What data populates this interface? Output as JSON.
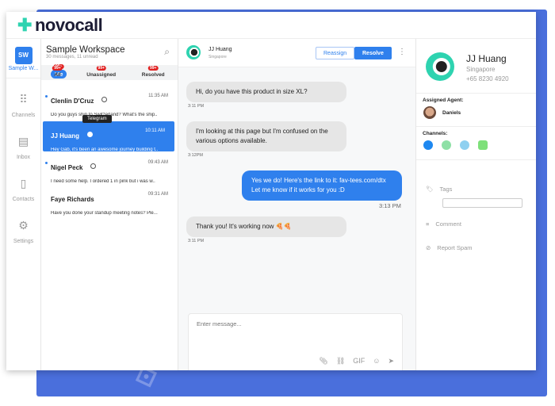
{
  "app": {
    "name": "novocall"
  },
  "rail": {
    "workspace_initials": "SW",
    "workspace_label": "Sample W...",
    "items": [
      {
        "label": "Channels",
        "icon": "grid-icon"
      },
      {
        "label": "Inbox",
        "icon": "chat-icon"
      },
      {
        "label": "Contacts",
        "icon": "book-icon"
      },
      {
        "label": "Settings",
        "icon": "gear-icon"
      }
    ]
  },
  "list": {
    "title": "Sample Workspace",
    "subtitle": "30 messages, 11 unread",
    "tabs": [
      {
        "label": "Me",
        "badge": "99+"
      },
      {
        "label": "All",
        "badge": "99+"
      },
      {
        "label": "Unassigned",
        "badge": "99+"
      },
      {
        "label": "Resolved",
        "badge": "99+"
      }
    ],
    "tooltip": "Telegram",
    "conversations": [
      {
        "name": "Clenlin D'Cruz",
        "time": "11:35 AM",
        "preview": "Do you guys ship to Switzerland? What's the ship..",
        "unread": true
      },
      {
        "name": "JJ Huang",
        "time": "10:11 AM",
        "preview": "Hey Gab, it's been an awesome journey building t..",
        "selected": true
      },
      {
        "name": "Nigel Peck",
        "time": "09:43 AM",
        "preview": "I need some help. I ordered 1 in pink but i was w..",
        "unread": true
      },
      {
        "name": "Faye Richards",
        "time": "09:31 AM",
        "preview": "Have you done your standup meeting notes? Ple..."
      }
    ]
  },
  "chat": {
    "name": "JJ Huang",
    "location": "Singapore",
    "reassign": "Reassign",
    "resolve": "Resolve",
    "messages": [
      {
        "text": "Hi, do you have this product in size XL?",
        "time": "3:11 PM"
      },
      {
        "text": "I'm looking at this page but I'm confused on the various options available.",
        "time": "3:12PM"
      },
      {
        "text": "Yes we do! Here's the link to it: fav-tees.com/dtx Let me know if it works for you :D",
        "time": "3:13 PM"
      },
      {
        "text": "Thank you! It's working now 🍕🍕",
        "time": "3:11 PM"
      }
    ],
    "placeholder": "Enter message...",
    "gif": "GIF"
  },
  "profile": {
    "name": "JJ Huang",
    "location": "Singapore",
    "phone": "+65 8230 4920",
    "assigned_label": "Assigned Agent:",
    "agent": "Daniels",
    "channels_label": "Channels:",
    "channels": [
      {
        "name": "messenger",
        "color": "#1e88f0"
      },
      {
        "name": "whatsapp",
        "color": "#8ee0a6"
      },
      {
        "name": "telegram",
        "color": "#8fd0f0"
      },
      {
        "name": "line",
        "color": "#7ee07a"
      }
    ],
    "tags": "Tags",
    "comment": "Comment",
    "report": "Report Spam"
  },
  "colors": {
    "accent": "#2f80ed",
    "background": "#4a6fdc"
  }
}
